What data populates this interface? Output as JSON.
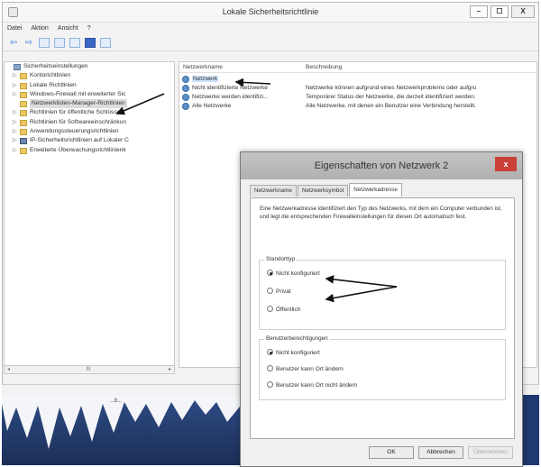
{
  "window": {
    "title": "Lokale Sicherheitsrichtlinie",
    "controls": [
      "–",
      "☐",
      "X"
    ]
  },
  "menu": [
    "Datei",
    "Aktion",
    "Ansicht",
    "?"
  ],
  "tree": {
    "items": [
      {
        "label": "Sicherheitseinstellungen",
        "expander": "",
        "level": 0,
        "icon": "root"
      },
      {
        "label": "Kontorichtlinien",
        "expander": "▷",
        "level": 1,
        "icon": "folder"
      },
      {
        "label": "Lokale Richtlinien",
        "expander": "▷",
        "level": 1,
        "icon": "folder"
      },
      {
        "label": "Windows-Firewall mit erweiterter Sic",
        "expander": "▷",
        "level": 1,
        "icon": "folder"
      },
      {
        "label": "Netzwerklisten-Manager-Richtlinien",
        "expander": "",
        "level": 1,
        "icon": "folder",
        "selected": true
      },
      {
        "label": "Richtlinien für öffentliche Schlüssel",
        "expander": "▷",
        "level": 1,
        "icon": "folder"
      },
      {
        "label": "Richtlinien für Softwareeinschränkun",
        "expander": "▷",
        "level": 1,
        "icon": "folder"
      },
      {
        "label": "Anwendungssteuerungsrichtlinien",
        "expander": "▷",
        "level": 1,
        "icon": "folder"
      },
      {
        "label": "IP-Sicherheitsrichtlinien auf Lokaler C",
        "expander": "▷",
        "level": 1,
        "icon": "shield"
      },
      {
        "label": "Erweiterte Überwachungsrichtlinienk",
        "expander": "▷",
        "level": 1,
        "icon": "folder"
      }
    ],
    "scroll_mid": "III"
  },
  "list": {
    "columns": [
      "Netzwerkname",
      "Beschreibung"
    ],
    "rows": [
      {
        "name": "Netzwerk",
        "desc": "",
        "selected": true
      },
      {
        "name": "Nicht identifizierte Netzwerke",
        "desc": "Netzwerke können aufgrund eines Netzwerkproblems oder aufgru"
      },
      {
        "name": "Netzwerke werden identifizi...",
        "desc": "Temporärer Status der Netzwerke, die derzeit identifiziert werden."
      },
      {
        "name": "Alle Netzwerke",
        "desc": "Alle Netzwerke, mit denen ein Benutzer eine Verbindung herstellt."
      }
    ]
  },
  "desktop": {
    "caption": "...lt..."
  },
  "dialog": {
    "title": "Eigenschaften von Netzwerk 2",
    "close": "x",
    "tabs": [
      "Netzwerkname",
      "Netzwerksymbol",
      "Netzwerkadresse"
    ],
    "active_tab": 2,
    "description": "Eine Netzwerkadresse identifiziert den Typ des Netzwerks, mit dem ein Computer verbunden ist, und legt die entsprechenden Firewalleinstellungen für diesen Ort automatisch fest.",
    "location_group": {
      "legend": "Standorttyp",
      "options": [
        "Nicht konfiguriert",
        "Privat",
        "Öffentlich"
      ],
      "selected": 0
    },
    "permissions_group": {
      "legend": "Benutzerberechtigungen",
      "options": [
        "Nicht konfiguriert",
        "Benutzer kann Ort ändern",
        "Benutzer kann Ort nicht ändern"
      ],
      "selected": 0
    },
    "buttons": {
      "ok": "OK",
      "cancel": "Abbrechen",
      "apply": "Übernehmen"
    }
  },
  "colors": {
    "dialog_close": "#c9403a",
    "selection": "#cfe4fa",
    "desktop": "#1f3870"
  }
}
